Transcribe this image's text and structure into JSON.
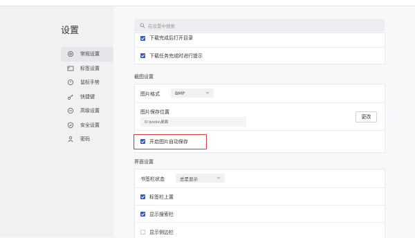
{
  "page_title": "设置",
  "search": {
    "placeholder": "在设置中搜索"
  },
  "sidebar": {
    "items": [
      {
        "label": "常规设置",
        "icon": "gear-icon",
        "active": true
      },
      {
        "label": "标签设置",
        "icon": "tab-icon",
        "active": false
      },
      {
        "label": "鼠标手势",
        "icon": "mouse-icon",
        "active": false
      },
      {
        "label": "快捷键",
        "icon": "key-icon",
        "active": false
      },
      {
        "label": "高级设置",
        "icon": "advanced-icon",
        "active": false
      },
      {
        "label": "安全设置",
        "icon": "shield-icon",
        "active": false
      },
      {
        "label": "密码",
        "icon": "user-icon",
        "active": false
      }
    ]
  },
  "download": {
    "partial_label": "下载完成后打开目录",
    "prompt_label": "下载任务完成时进行提示"
  },
  "screenshot": {
    "section_title": "截图设置",
    "format_label": "图片格式",
    "format_value": "BMP",
    "save_location_label": "图片保存位置",
    "save_path": "D:\\tools\\桌面",
    "change_button": "更改",
    "auto_save_label": "开启图片自动保存"
  },
  "interface": {
    "section_title": "界面设置",
    "bookmark_bar_label": "书签栏状态",
    "bookmark_bar_value": "总是显示",
    "tab_bar_top_label": "标签栏上置",
    "show_search_bar_label": "显示搜索栏",
    "show_sidebar_label": "显示侧边栏"
  },
  "colors": {
    "accent": "#2f5bd3",
    "highlight_border": "#d63b3b"
  }
}
